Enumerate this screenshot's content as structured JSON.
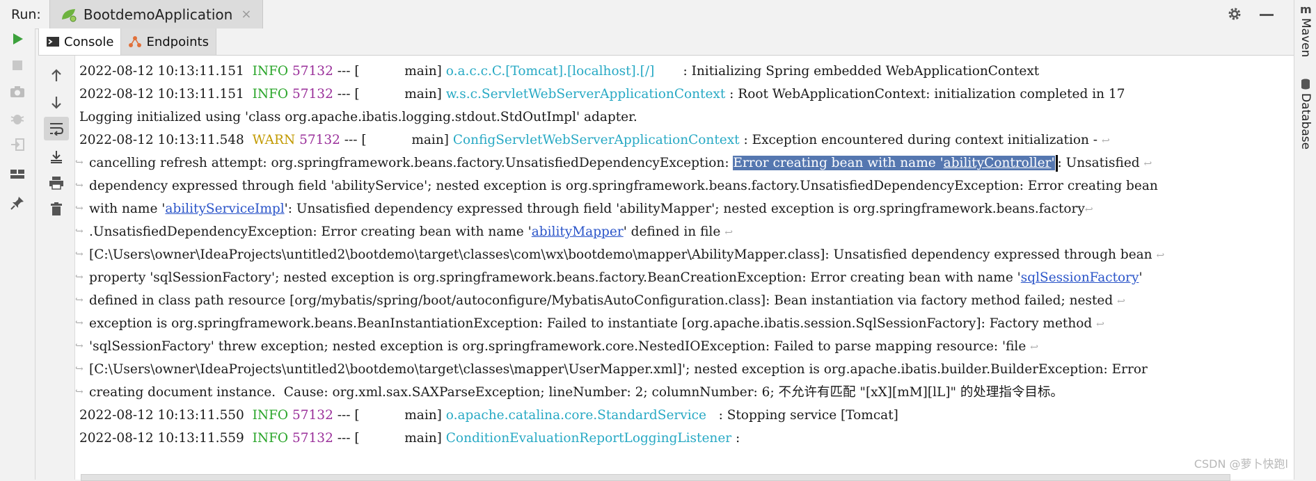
{
  "window": {
    "run_label": "Run:",
    "tab_title": "BootdemoApplication",
    "tab_close": "×"
  },
  "subtabs": [
    {
      "label": "Console",
      "active": true
    },
    {
      "label": "Endpoints",
      "active": false
    }
  ],
  "right_panel": {
    "maven_label": "Maven",
    "database_label": "Database"
  },
  "colors": {
    "info": "#2aa52a",
    "warn": "#c29a00",
    "pid": "#9a2f9a",
    "logger": "#27a9c4",
    "link": "#2a54c9",
    "highlight": "#5577b0"
  },
  "console": {
    "log1": {
      "time": "2022-08-12 10:13:11.151",
      "level": "INFO",
      "pid": "57132",
      "sep": " --- [",
      "thread": "main]",
      "logger": "o.a.c.c.C.[Tomcat].[localhost].[/]",
      "message": ": Initializing Spring embedded WebApplicationContext"
    },
    "log2": {
      "time": "2022-08-12 10:13:11.151",
      "level": "INFO",
      "pid": "57132",
      "sep": " --- [",
      "thread": "main]",
      "logger": "w.s.c.ServletWebServerApplicationContext",
      "message": ": Root WebApplicationContext: initialization completed in 17"
    },
    "plain_line": "Logging initialized using 'class org.apache.ibatis.logging.stdout.StdOutImpl' adapter.",
    "log3": {
      "time": "2022-08-12 10:13:11.548",
      "level": "WARN",
      "pid": "57132",
      "sep": " --- [",
      "thread": "main]",
      "logger": "ConfigServletWebServerApplicationContext",
      "message": ": Exception encountered during context initialization -"
    },
    "w1_a": "cancelling refresh attempt: org.springframework.beans.factory.UnsatisfiedDependencyException: ",
    "w1_hl_a": "Error creating bean with name '",
    "w1_link": "abilityController",
    "w1_hl_b": "'",
    "w1_b": ": Unsatisfied",
    "w2": "dependency expressed through field 'abilityService'; nested exception is org.springframework.beans.factory.UnsatisfiedDependencyException: Error creating bean",
    "w3_a": "with name '",
    "w3_link": "abilityServiceImpl",
    "w3_b": "': Unsatisfied dependency expressed through field 'abilityMapper'; nested exception is org.springframework.beans.factory",
    "w4_a": ".UnsatisfiedDependencyException: Error creating bean with name '",
    "w4_link": "abilityMapper",
    "w4_b": "' defined in file",
    "w5": "[C:\\Users\\owner\\IdeaProjects\\untitled2\\bootdemo\\target\\classes\\com\\wx\\bootdemo\\mapper\\AbilityMapper.class]: Unsatisfied dependency expressed through bean",
    "w6_a": "property 'sqlSessionFactory'; nested exception is org.springframework.beans.factory.BeanCreationException: Error creating bean with name '",
    "w6_link": "sqlSessionFactory",
    "w6_b": "'",
    "w7": "defined in class path resource [org/mybatis/spring/boot/autoconfigure/MybatisAutoConfiguration.class]: Bean instantiation via factory method failed; nested",
    "w8": "exception is org.springframework.beans.BeanInstantiationException: Failed to instantiate [org.apache.ibatis.session.SqlSessionFactory]: Factory method",
    "w9": "'sqlSessionFactory' threw exception; nested exception is org.springframework.core.NestedIOException: Failed to parse mapping resource: 'file",
    "w10": "[C:\\Users\\owner\\IdeaProjects\\untitled2\\bootdemo\\target\\classes\\mapper\\UserMapper.xml]'; nested exception is org.apache.ibatis.builder.BuilderException: Error",
    "w11": "creating document instance.  Cause: org.xml.sax.SAXParseException; lineNumber: 2; columnNumber: 6; 不允许有匹配 \"[xX][mM][lL]\" 的处理指令目标。",
    "log4": {
      "time": "2022-08-12 10:13:11.550",
      "level": "INFO",
      "pid": "57132",
      "sep": " --- [",
      "thread": "main]",
      "logger": "o.apache.catalina.core.StandardService",
      "message": ": Stopping service [Tomcat]"
    },
    "log5": {
      "time": "2022-08-12 10:13:11.559",
      "level": "INFO",
      "pid": "57132",
      "sep": " --- [",
      "thread": "main]",
      "logger": "ConditionEvaluationReportLoggingListener",
      "message": ":"
    }
  },
  "watermark": "CSDN @萝卜快跑l"
}
